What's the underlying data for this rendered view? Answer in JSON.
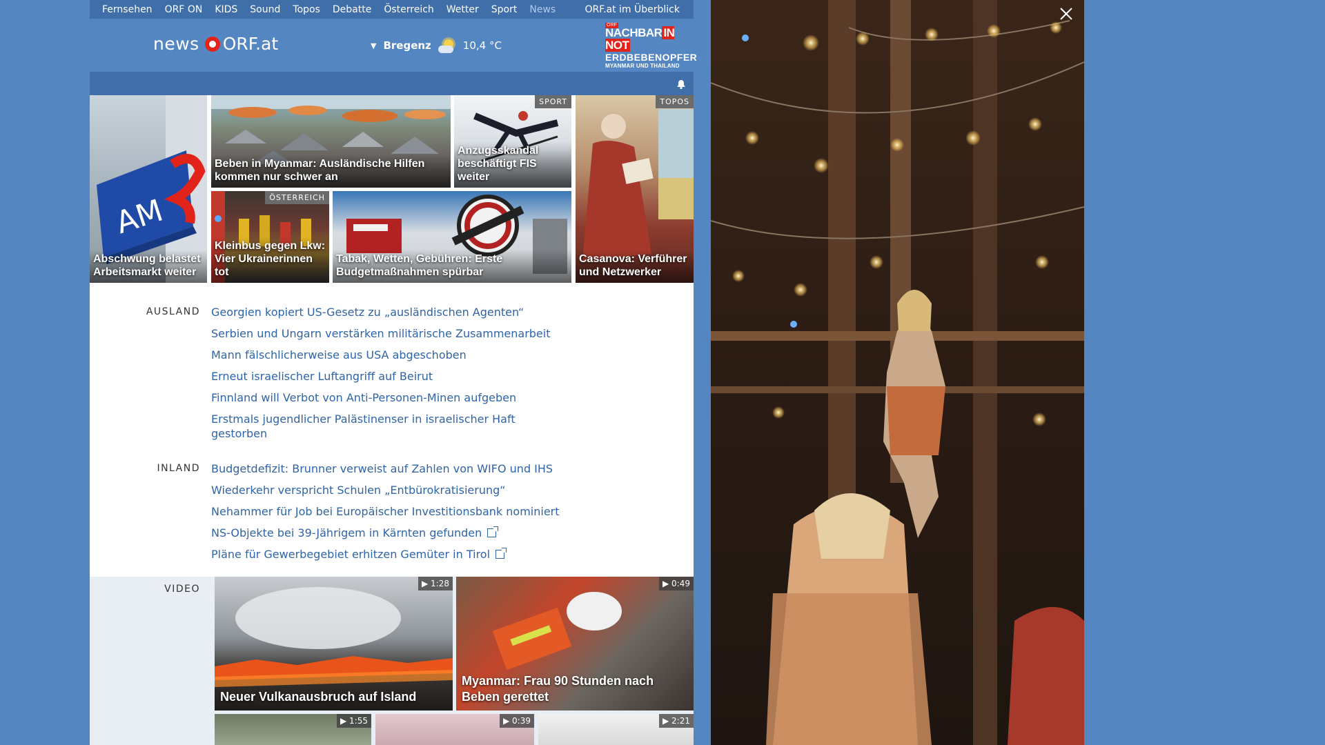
{
  "topnav": {
    "items": [
      "Fernsehen",
      "ORF ON",
      "KIDS",
      "Sound",
      "Topos",
      "Debatte",
      "Österreich",
      "Wetter",
      "Sport",
      "News"
    ],
    "overview": "ORF.at im Überblick"
  },
  "header": {
    "logo_news": "news",
    "logo_orf": "ORF.at",
    "weather": {
      "location": "Bregenz",
      "temperature": "10,4 °C",
      "icon": "sun-cloud-icon"
    },
    "promo": {
      "small": "ORF",
      "line1_a": "NACHBAR",
      "line1_b": "IN NOT",
      "line2": "ERDBEBENOPFER",
      "line3": "MYANMAR UND THAILAND"
    }
  },
  "tiles": [
    {
      "caption": "Abschwung belastet Arbeitsmarkt weiter",
      "tag": ""
    },
    {
      "caption": "Beben in Myanmar: Ausländische Hilfen kommen nur schwer an",
      "tag": ""
    },
    {
      "caption": "Anzugsskandal beschäftigt FIS weiter",
      "tag": "SPORT"
    },
    {
      "caption": "Casanova: Verführer und Netzwerker",
      "tag": "TOPOS"
    },
    {
      "caption": "Kleinbus gegen Lkw: Vier Ukrainerinnen tot",
      "tag": "ÖSTERREICH"
    },
    {
      "caption": "Tabak, Wetten, Gebühren: Erste Budgetmaßnahmen spürbar",
      "tag": ""
    }
  ],
  "ausland": {
    "label": "AUSLAND",
    "items": [
      "Georgien kopiert US-Gesetz zu „ausländischen Agenten“",
      "Serbien und Ungarn verstärken militärische Zusammenarbeit",
      "Mann fälschlicherweise aus USA abgeschoben",
      "Erneut israelischer Luftangriff auf Beirut",
      "Finnland will Verbot von Anti-Personen-Minen aufgeben",
      "Erstmals jugendlicher Palästinenser in israelischer Haft gestorben"
    ]
  },
  "inland": {
    "label": "INLAND",
    "items": [
      "Budgetdefizit: Brunner verweist auf Zahlen von WIFO und IHS",
      "Wiederkehr verspricht Schulen „Entbürokratisierung“",
      "Nehammer für Job bei Europäischer Investitionsbank nominiert",
      "NS-Objekte bei 39-Jährigem in Kärnten gefunden",
      "Pläne für Gewerbegebiet erhitzen Gemüter in Tirol"
    ]
  },
  "video": {
    "label": "VIDEO",
    "items": [
      {
        "caption": "Neuer Vulkanausbruch auf Island",
        "duration": "1:28"
      },
      {
        "caption": "Myanmar: Frau 90 Stunden nach Beben gerettet",
        "duration": "0:49"
      },
      {
        "caption": "",
        "duration": "1:55"
      },
      {
        "caption": "",
        "duration": "0:39"
      },
      {
        "caption": "",
        "duration": "2:21"
      }
    ]
  },
  "colors": {
    "brand_blue": "#5486c1",
    "nav_blue": "#3f6ea8",
    "link_blue": "#2f64a6",
    "orf_red": "#e2231a"
  }
}
